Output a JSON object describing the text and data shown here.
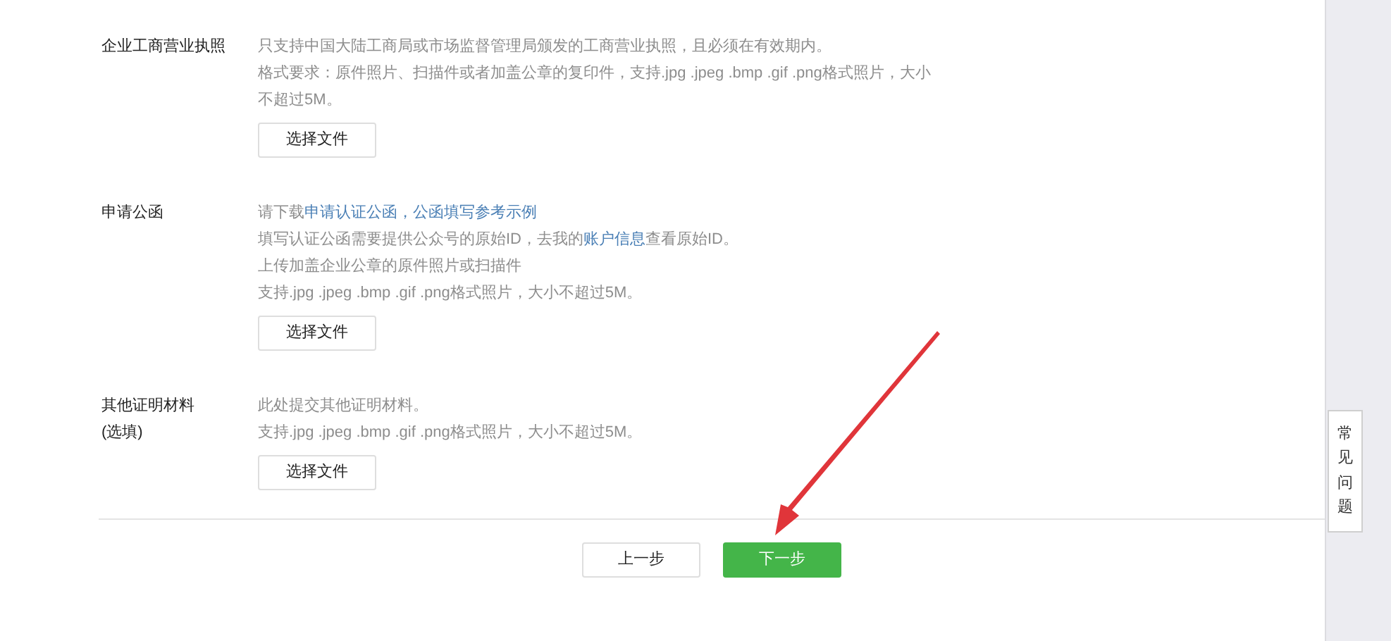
{
  "sections": [
    {
      "label": [
        "企业工商营业执照"
      ],
      "paragraphs": [
        [
          {
            "kind": "text",
            "text": "只支持中国大陆工商局或市场监督管理局颁发的工商营业执照，且必须在有效期内。"
          }
        ],
        [
          {
            "kind": "text",
            "text": "格式要求：原件照片、扫描件或者加盖公章的复印件，支持.jpg .jpeg .bmp .gif .png格式照片，大小不超过5M。"
          }
        ]
      ],
      "button": "选择文件"
    },
    {
      "label": [
        "申请公函"
      ],
      "paragraphs": [
        [
          {
            "kind": "text",
            "text": "请下载"
          },
          {
            "kind": "link",
            "text": "申请认证公函，"
          },
          {
            "kind": "link",
            "text": "公函填写参考示例"
          }
        ],
        [
          {
            "kind": "text",
            "text": "填写认证公函需要提供公众号的原始ID，去我的"
          },
          {
            "kind": "link",
            "text": "账户信息"
          },
          {
            "kind": "text",
            "text": "查看原始ID。"
          }
        ],
        [
          {
            "kind": "text",
            "text": "上传加盖企业公章的原件照片或扫描件"
          }
        ],
        [
          {
            "kind": "text",
            "text": "支持.jpg .jpeg .bmp .gif .png格式照片，大小不超过5M。"
          }
        ]
      ],
      "button": "选择文件"
    },
    {
      "label": [
        "其他证明材料",
        "(选填)"
      ],
      "paragraphs": [
        [
          {
            "kind": "text",
            "text": "此处提交其他证明材料。"
          }
        ],
        [
          {
            "kind": "text",
            "text": "支持.jpg .jpeg .bmp .gif .png格式照片，大小不超过5M。"
          }
        ]
      ],
      "button": "选择文件"
    }
  ],
  "footer_buttons": [
    {
      "label": "上一步",
      "kind": "secondary"
    },
    {
      "label": "下一步",
      "kind": "primary"
    }
  ],
  "side_tab": "常见问题"
}
